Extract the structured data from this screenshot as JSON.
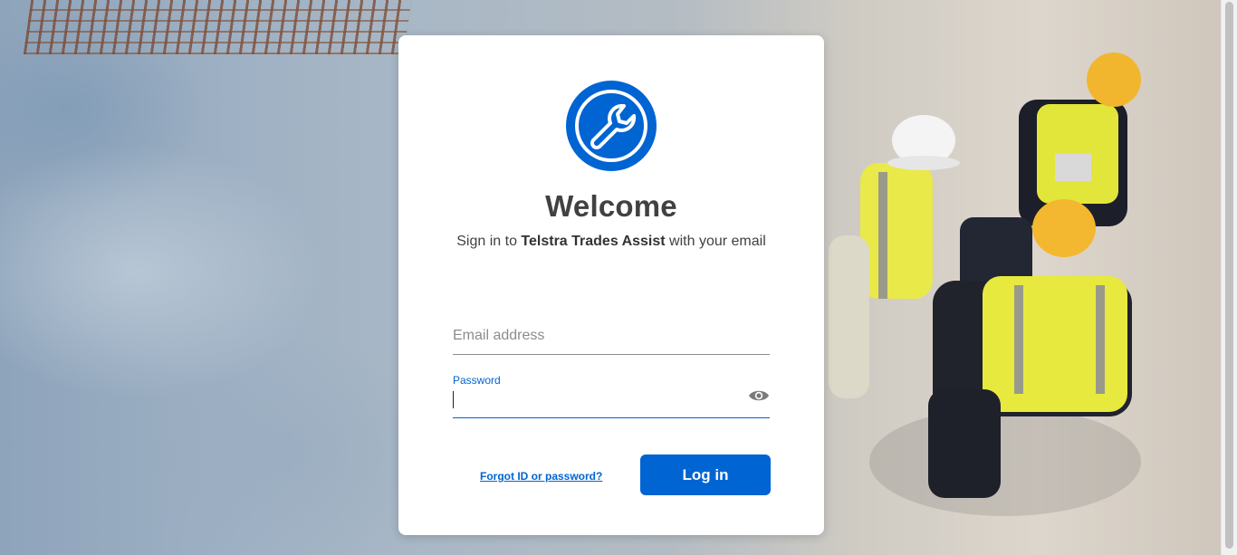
{
  "login_card": {
    "logo_icon": "wrench-icon",
    "title": "Welcome",
    "subtitle_prefix": "Sign in to ",
    "subtitle_app": "Telstra Trades Assist",
    "subtitle_suffix": " with your email",
    "email": {
      "placeholder": "Email address",
      "value": ""
    },
    "password": {
      "label": "Password",
      "value": "",
      "toggle_icon": "eye-icon"
    },
    "forgot_link": "Forgot ID or password?",
    "login_button": "Log in"
  },
  "colors": {
    "brand_blue": "#0064d2",
    "text_dark": "#414141",
    "card_bg": "#ffffff"
  }
}
